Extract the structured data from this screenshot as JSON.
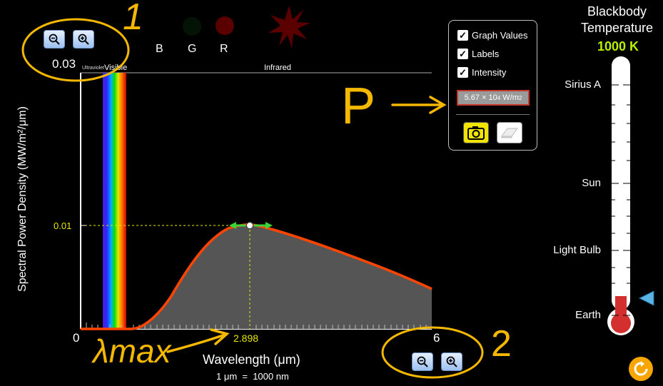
{
  "top_zoom": {
    "value": "0.03"
  },
  "filters": {
    "b": "B",
    "g": "G",
    "r": "R"
  },
  "bands": {
    "uv": "Ultraviolet",
    "visible": "Visible",
    "ir": "Infrared"
  },
  "y_axis": {
    "label": "Spectral Power Density (MW/m²/μm)",
    "tick": "0.01"
  },
  "x_axis": {
    "min": "0",
    "max": "6",
    "peak": "2.898",
    "label": "Wavelength (μm)",
    "unit_note": "1 μm  =  1000 nm"
  },
  "options": {
    "graph_values": "Graph Values",
    "labels": "Labels",
    "intensity": "Intensity",
    "intensity_value": "5.67 × 10",
    "intensity_exp": "4",
    "intensity_unit": " W/m",
    "intensity_unit_exp": "2"
  },
  "thermometer": {
    "title_line1": "Blackbody",
    "title_line2": "Temperature",
    "temperature": "1000 K",
    "marks": {
      "sirius": "Sirius A",
      "sun": "Sun",
      "bulb": "Light Bulb",
      "earth": "Earth"
    }
  },
  "annotations": {
    "one": "1",
    "two": "2",
    "p": "P",
    "lambda_max": "λmax"
  },
  "colors": {
    "curve": "#ff4500",
    "accent_yellow": "#e6e600",
    "annotation": "#f5b800",
    "mercury": "#d32f2f"
  }
}
